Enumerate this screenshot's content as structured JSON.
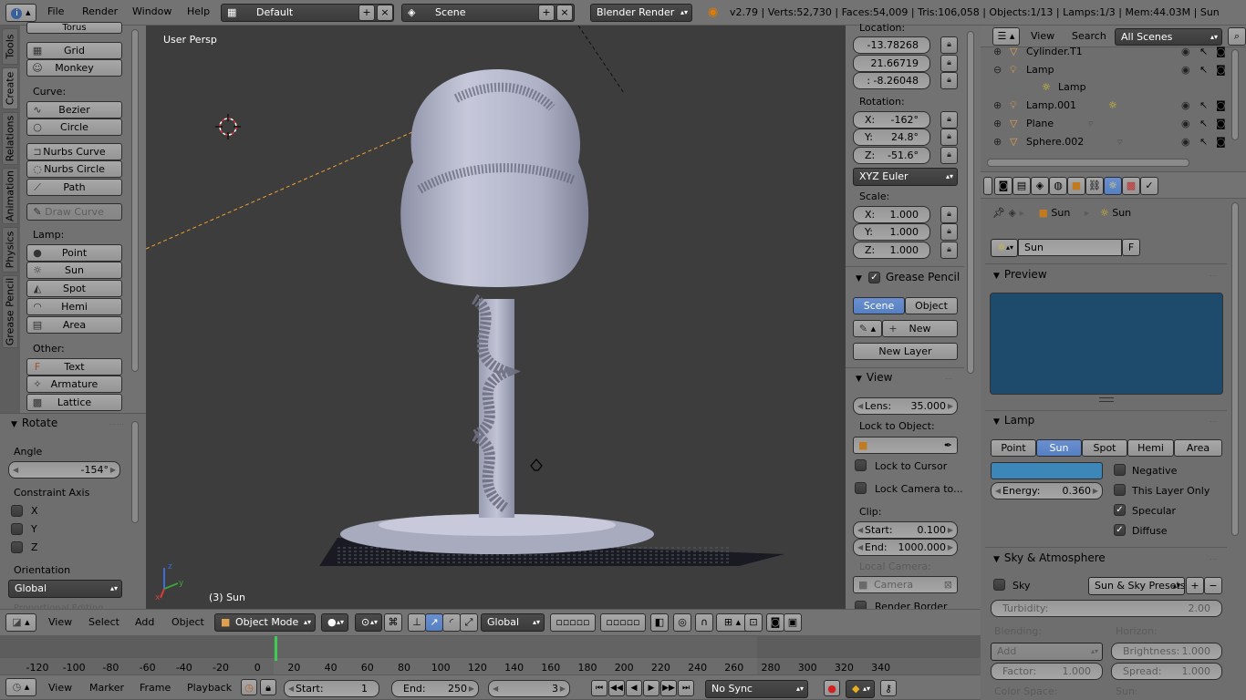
{
  "topbar": {
    "menus": [
      "File",
      "Render",
      "Window",
      "Help"
    ],
    "layout": "Default",
    "scene": "Scene",
    "engine": "Blender Render",
    "stats": "v2.79 | Verts:52,730 | Faces:54,009 | Tris:106,058 | Objects:1/13 | Lamps:1/3 | Mem:44.03M | Sun"
  },
  "toolshelf": {
    "tabs": [
      "Tools",
      "Create",
      "Relations",
      "Animation",
      "Physics",
      "Grease Pencil"
    ],
    "partial_top": "Torus",
    "mesh": [
      "Grid",
      "Monkey"
    ],
    "curve_label": "Curve:",
    "curve": [
      "Bezier",
      "Circle",
      "Nurbs Curve",
      "Nurbs Circle",
      "Path",
      "Draw Curve"
    ],
    "lamp_label": "Lamp:",
    "lamp": [
      "Point",
      "Sun",
      "Spot",
      "Hemi",
      "Area"
    ],
    "other_label": "Other:",
    "other": [
      "Text",
      "Armature",
      "Lattice"
    ]
  },
  "operator": {
    "title": "Rotate",
    "angle_label": "Angle",
    "angle_value": "-154°",
    "constraint_label": "Constraint Axis",
    "axes": [
      "X",
      "Y",
      "Z"
    ],
    "orientation_label": "Orientation",
    "orientation_value": "Global",
    "partial_bottom": "Proportional Editing"
  },
  "viewport": {
    "view_name": "User Persp",
    "object_label": "(3) Sun"
  },
  "npanel": {
    "location_label": "Location:",
    "location": [
      "-13.78268",
      "21.66719",
      ": -8.26048"
    ],
    "rotation_label": "Rotation:",
    "rotation": [
      {
        "axis": "X:",
        "value": "-162°"
      },
      {
        "axis": "Y:",
        "value": "24.8°"
      },
      {
        "axis": "Z:",
        "value": "-51.6°"
      }
    ],
    "rotation_mode": "XYZ Euler",
    "scale_label": "Scale:",
    "scale": [
      {
        "axis": "X:",
        "value": "1.000"
      },
      {
        "axis": "Y:",
        "value": "1.000"
      },
      {
        "axis": "Z:",
        "value": "1.000"
      }
    ],
    "grease_title": "Grease Pencil L",
    "grease_scene": "Scene",
    "grease_object": "Object",
    "grease_new": "New",
    "grease_new_layer": "New Layer",
    "view_title": "View",
    "lens_label": "Lens:",
    "lens_value": "35.000",
    "lock_object_label": "Lock to Object:",
    "lock_cursor": "Lock to Cursor",
    "lock_camera": "Lock Camera to...",
    "clip_label": "Clip:",
    "clip_start_label": "Start:",
    "clip_start": "0.100",
    "clip_end_label": "End:",
    "clip_end": "1000.000",
    "local_camera_label": "Local Camera:",
    "camera_placeholder": "Camera",
    "render_border": "Render Border"
  },
  "outliner": {
    "menus": [
      "View",
      "Search"
    ],
    "filter": "All Scenes",
    "rows": [
      {
        "name": "Cylinder.T1",
        "indent": 0
      },
      {
        "name": "Lamp",
        "indent": 0
      },
      {
        "name": "Lamp",
        "indent": 1
      },
      {
        "name": "Lamp.001",
        "indent": 0
      },
      {
        "name": "Plane",
        "indent": 0
      },
      {
        "name": "Sphere.002",
        "indent": 0
      }
    ]
  },
  "properties": {
    "breadcrumb": [
      "Sun",
      "Sun"
    ],
    "datablock": "Sun",
    "datablock_f": "F",
    "preview_title": "Preview",
    "preview_color": "#1e4a6b",
    "lamp_title": "Lamp",
    "lamp_types": [
      "Point",
      "Sun",
      "Spot",
      "Hemi",
      "Area"
    ],
    "lamp_active": "Sun",
    "lamp_color": "#3c86b8",
    "negative": "Negative",
    "this_layer": "This Layer Only",
    "specular": "Specular",
    "diffuse": "Diffuse",
    "energy_label": "Energy:",
    "energy_value": "0.360",
    "sky_title": "Sky & Atmosphere",
    "sky_label": "Sky",
    "sky_presets": "Sun & Sky Presets",
    "turbidity_label": "Turbidity:",
    "turbidity_value": "2.00",
    "blending_label": "Blending:",
    "horizon_label": "Horizon:",
    "blend_value": "Add",
    "brightness_label": "Brightness:",
    "brightness_value": "1.000",
    "factor_label": "Factor:",
    "factor_value": "1.000",
    "spread_label": "Spread:",
    "spread_value": "1.000",
    "colorspace_label": "Color Space:",
    "sun_label": "Sun:"
  },
  "view3d_header": {
    "menus": [
      "View",
      "Select",
      "Add",
      "Object"
    ],
    "mode": "Object Mode",
    "orientation": "Global"
  },
  "timeline": {
    "ticks": [
      "-120",
      "-100",
      "-80",
      "-60",
      "-40",
      "-20",
      "0",
      "20",
      "40",
      "60",
      "80",
      "100",
      "120",
      "140",
      "160",
      "180",
      "200",
      "220",
      "240",
      "260",
      "280",
      "300",
      "320",
      "340"
    ],
    "menus": [
      "View",
      "Marker",
      "Frame",
      "Playback"
    ],
    "start_label": "Start:",
    "start": "1",
    "end_label": "End:",
    "end": "250",
    "current": "3",
    "sync": "No Sync"
  }
}
